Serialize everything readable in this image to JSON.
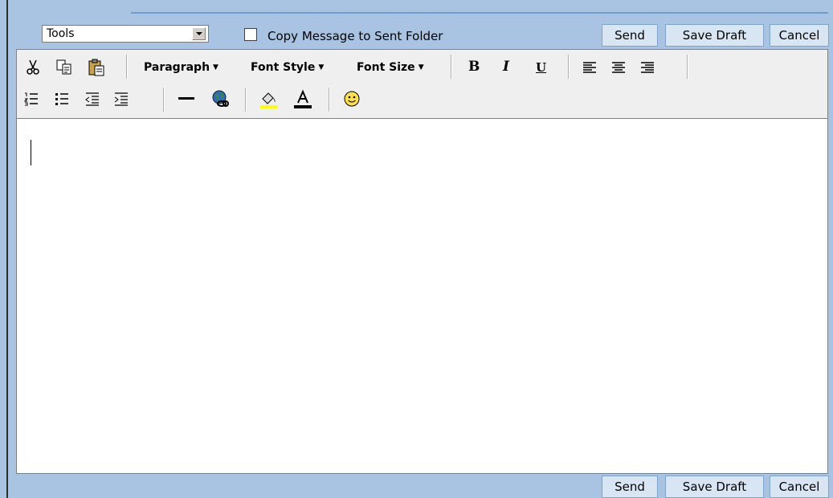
{
  "top_bar": {
    "tools_select_value": "Tools",
    "copy_to_sent_label": "Copy Message to Sent Folder",
    "copy_to_sent_checked": false
  },
  "actions": {
    "send": "Send",
    "save_draft": "Save Draft",
    "cancel": "Cancel"
  },
  "toolbar": {
    "paragraph": "Paragraph",
    "font_style": "Font Style",
    "font_size": "Font Size",
    "bold": "B",
    "italic": "I",
    "underline": "U",
    "icons_row1": [
      "cut-icon",
      "copy-icon",
      "paste-icon",
      "align-left-icon",
      "align-center-icon",
      "align-right-icon"
    ],
    "icons_row2": [
      "ordered-list-icon",
      "unordered-list-icon",
      "outdent-icon",
      "indent-icon",
      "horizontal-rule-icon",
      "insert-link-icon",
      "highlight-color-icon",
      "font-color-icon",
      "emoticon-icon"
    ]
  },
  "editor": {
    "content": ""
  },
  "colors": {
    "frame": "#a9c4e2",
    "button": "#d8e6f4",
    "toolbar": "#efefef"
  }
}
